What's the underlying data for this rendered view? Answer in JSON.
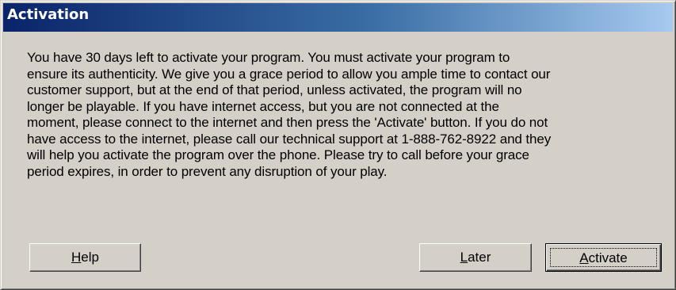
{
  "window": {
    "title": "Activation"
  },
  "message": {
    "lines": [
      "You have 30 days left to activate your program.  You must activate your program to",
      "ensure its authenticity. We give you a grace period to allow you ample time to contact our",
      "customer support, but at the end of that period, unless activated, the program will no",
      "longer be playable. If you have internet access, but you are not connected at the",
      "moment, please connect to the internet and then press the 'Activate' button. If you do not",
      "have access to the internet, please call our technical support at 1-888-762-8922 and they",
      "will help you activate the program over the phone. Please try to call before your grace",
      "period expires, in order to prevent any disruption of your play."
    ]
  },
  "buttons": {
    "help": {
      "mnemonic": "H",
      "rest": "elp"
    },
    "later": {
      "mnemonic": "L",
      "rest": "ater"
    },
    "activate": {
      "mnemonic": "A",
      "rest": "ctivate"
    }
  },
  "colors": {
    "face": "#d4d0c8",
    "title_start": "#0a246a",
    "title_end": "#a6caf0",
    "title_text": "#ffffff"
  }
}
